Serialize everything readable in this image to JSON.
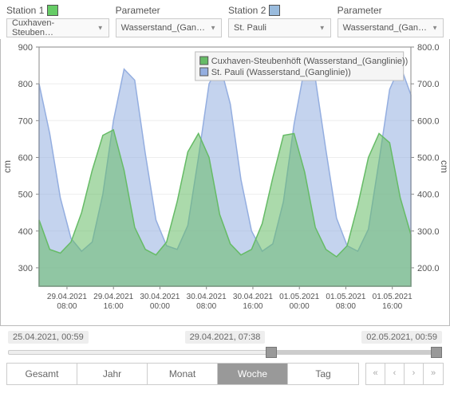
{
  "controls": {
    "station1_label": "Station 1",
    "station1_value": "Cuxhaven-Steuben…",
    "param1_label": "Parameter",
    "param1_value": "Wasserstand_(Gan…",
    "station2_label": "Station 2",
    "station2_value": "St. Pauli",
    "param2_label": "Parameter",
    "param2_value": "Wasserstand_(Gan…"
  },
  "legend": {
    "series_a": "Cuxhaven-Steubenhöft (Wasserstand_(Ganglinie))",
    "series_b": "St. Pauli (Wasserstand_(Ganglinie))"
  },
  "axes": {
    "left_unit": "cm",
    "right_unit": "cm",
    "left_ticks": [
      "300",
      "400",
      "500",
      "600",
      "700",
      "800",
      "900"
    ],
    "right_ticks": [
      "200.0",
      "300.0",
      "400.0",
      "500.0",
      "600.0",
      "700.0",
      "800.0"
    ],
    "x_ticks": [
      "29.04.2021",
      "29.04.2021",
      "30.04.2021",
      "30.04.2021",
      "30.04.2021",
      "01.05.2021",
      "01.05.2021",
      "01.05.2021"
    ],
    "x_ticks2": [
      "08:00",
      "16:00",
      "00:00",
      "08:00",
      "16:00",
      "00:00",
      "08:00",
      "16:00"
    ]
  },
  "range": {
    "left": "25.04.2021, 00:59",
    "mid": "29.04.2021, 07:38",
    "right": "02.05.2021, 00:59"
  },
  "tabs": {
    "gesamt": "Gesamt",
    "jahr": "Jahr",
    "monat": "Monat",
    "woche": "Woche",
    "tag": "Tag"
  },
  "chart_data": {
    "type": "area",
    "xlabel": "",
    "ylim_left": [
      250,
      900
    ],
    "ylim_right": [
      150,
      800
    ],
    "x": [
      0,
      2,
      4,
      6,
      8,
      10,
      12,
      14,
      16,
      18,
      20,
      22,
      24,
      26,
      28,
      30,
      32,
      34,
      36,
      38,
      40,
      42,
      44,
      46,
      48,
      50,
      52,
      54,
      56,
      58,
      60,
      62,
      64,
      66,
      68,
      70
    ],
    "series": [
      {
        "name": "Cuxhaven-Steubenhöft (Wasserstand_(Ganglinie))",
        "axis": "left",
        "color": "#66bb66",
        "values": [
          430,
          350,
          340,
          370,
          450,
          565,
          660,
          675,
          565,
          410,
          350,
          335,
          370,
          480,
          615,
          665,
          600,
          445,
          365,
          335,
          350,
          420,
          545,
          660,
          665,
          560,
          410,
          350,
          330,
          360,
          470,
          600,
          665,
          640,
          490,
          390
        ]
      },
      {
        "name": "St. Pauli (Wasserstand_(Ganglinie))",
        "axis": "left",
        "color": "#94aee0",
        "values": [
          800,
          665,
          490,
          380,
          345,
          370,
          500,
          700,
          840,
          810,
          610,
          430,
          360,
          350,
          415,
          600,
          800,
          855,
          745,
          540,
          400,
          345,
          365,
          480,
          690,
          845,
          815,
          620,
          435,
          360,
          345,
          405,
          590,
          785,
          850,
          770
        ]
      }
    ]
  }
}
